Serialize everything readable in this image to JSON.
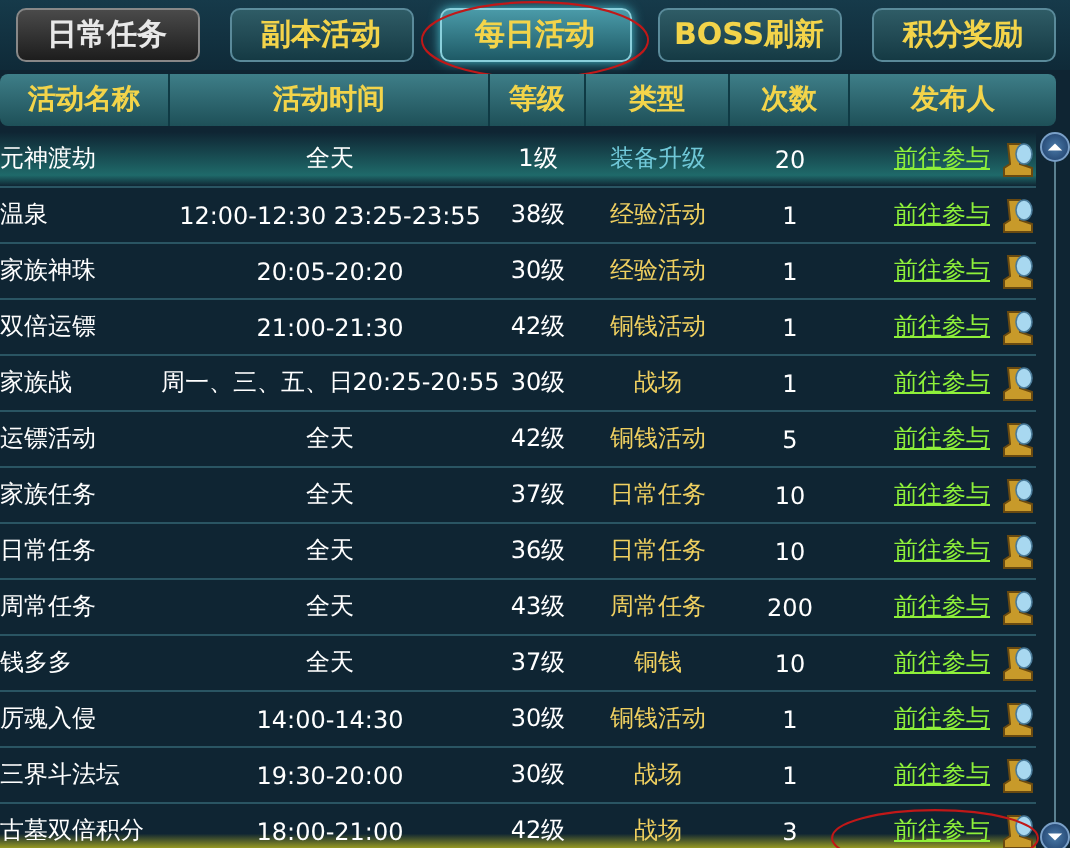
{
  "tabs": [
    {
      "label": "日常任务",
      "selected": false,
      "disabled": true,
      "circled": false
    },
    {
      "label": "副本活动",
      "selected": false,
      "disabled": false,
      "circled": false
    },
    {
      "label": "每日活动",
      "selected": true,
      "disabled": false,
      "circled": true
    },
    {
      "label": "BOSS刷新",
      "selected": false,
      "disabled": false,
      "circled": false
    },
    {
      "label": "积分奖励",
      "selected": false,
      "disabled": false,
      "circled": false
    }
  ],
  "table": {
    "columns": [
      "活动名称",
      "活动时间",
      "等级",
      "类型",
      "次数",
      "发布人"
    ],
    "rows": [
      {
        "name": "元神渡劫",
        "time": "全天",
        "level": "1级",
        "type": "装备升级",
        "count": "20",
        "link": "前往参与",
        "selected": true,
        "flagged": false,
        "circled": false
      },
      {
        "name": "温泉",
        "time": "12:00-12:30 23:25-23:55",
        "level": "38级",
        "type": "经验活动",
        "count": "1",
        "link": "前往参与",
        "selected": false,
        "flagged": false,
        "circled": false
      },
      {
        "name": "家族神珠",
        "time": "20:05-20:20",
        "level": "30级",
        "type": "经验活动",
        "count": "1",
        "link": "前往参与",
        "selected": false,
        "flagged": false,
        "circled": false
      },
      {
        "name": "双倍运镖",
        "time": "21:00-21:30",
        "level": "42级",
        "type": "铜钱活动",
        "count": "1",
        "link": "前往参与",
        "selected": false,
        "flagged": false,
        "circled": false
      },
      {
        "name": "家族战",
        "time": "周一、三、五、日20:25-20:55",
        "level": "30级",
        "type": "战场",
        "count": "1",
        "link": "前往参与",
        "selected": false,
        "flagged": false,
        "circled": false
      },
      {
        "name": "运镖活动",
        "time": "全天",
        "level": "42级",
        "type": "铜钱活动",
        "count": "5",
        "link": "前往参与",
        "selected": false,
        "flagged": false,
        "circled": false
      },
      {
        "name": "家族任务",
        "time": "全天",
        "level": "37级",
        "type": "日常任务",
        "count": "10",
        "link": "前往参与",
        "selected": false,
        "flagged": false,
        "circled": false
      },
      {
        "name": "日常任务",
        "time": "全天",
        "level": "36级",
        "type": "日常任务",
        "count": "10",
        "link": "前往参与",
        "selected": false,
        "flagged": false,
        "circled": false
      },
      {
        "name": "周常任务",
        "time": "全天",
        "level": "43级",
        "type": "周常任务",
        "count": "200",
        "link": "前往参与",
        "selected": false,
        "flagged": false,
        "circled": false
      },
      {
        "name": "钱多多",
        "time": "全天",
        "level": "37级",
        "type": "铜钱",
        "count": "10",
        "link": "前往参与",
        "selected": false,
        "flagged": false,
        "circled": false
      },
      {
        "name": "厉魂入侵",
        "time": "14:00-14:30",
        "level": "30级",
        "type": "铜钱活动",
        "count": "1",
        "link": "前往参与",
        "selected": false,
        "flagged": false,
        "circled": false
      },
      {
        "name": "三界斗法坛",
        "time": "19:30-20:00",
        "level": "30级",
        "type": "战场",
        "count": "1",
        "link": "前往参与",
        "selected": false,
        "flagged": false,
        "circled": false
      },
      {
        "name": "古墓双倍积分",
        "time": "18:00-21:00",
        "level": "42级",
        "type": "战场",
        "count": "3",
        "link": "前往参与",
        "selected": false,
        "flagged": true,
        "circled": true
      }
    ]
  }
}
